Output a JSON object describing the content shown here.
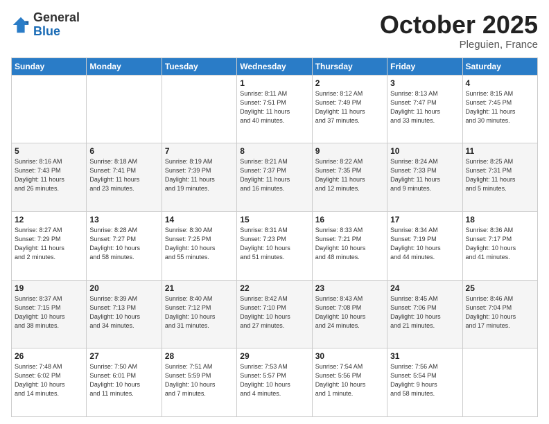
{
  "header": {
    "logo_general": "General",
    "logo_blue": "Blue",
    "month_title": "October 2025",
    "location": "Pleguien, France"
  },
  "days_of_week": [
    "Sunday",
    "Monday",
    "Tuesday",
    "Wednesday",
    "Thursday",
    "Friday",
    "Saturday"
  ],
  "weeks": [
    [
      {
        "day": "",
        "info": ""
      },
      {
        "day": "",
        "info": ""
      },
      {
        "day": "",
        "info": ""
      },
      {
        "day": "1",
        "info": "Sunrise: 8:11 AM\nSunset: 7:51 PM\nDaylight: 11 hours\nand 40 minutes."
      },
      {
        "day": "2",
        "info": "Sunrise: 8:12 AM\nSunset: 7:49 PM\nDaylight: 11 hours\nand 37 minutes."
      },
      {
        "day": "3",
        "info": "Sunrise: 8:13 AM\nSunset: 7:47 PM\nDaylight: 11 hours\nand 33 minutes."
      },
      {
        "day": "4",
        "info": "Sunrise: 8:15 AM\nSunset: 7:45 PM\nDaylight: 11 hours\nand 30 minutes."
      }
    ],
    [
      {
        "day": "5",
        "info": "Sunrise: 8:16 AM\nSunset: 7:43 PM\nDaylight: 11 hours\nand 26 minutes."
      },
      {
        "day": "6",
        "info": "Sunrise: 8:18 AM\nSunset: 7:41 PM\nDaylight: 11 hours\nand 23 minutes."
      },
      {
        "day": "7",
        "info": "Sunrise: 8:19 AM\nSunset: 7:39 PM\nDaylight: 11 hours\nand 19 minutes."
      },
      {
        "day": "8",
        "info": "Sunrise: 8:21 AM\nSunset: 7:37 PM\nDaylight: 11 hours\nand 16 minutes."
      },
      {
        "day": "9",
        "info": "Sunrise: 8:22 AM\nSunset: 7:35 PM\nDaylight: 11 hours\nand 12 minutes."
      },
      {
        "day": "10",
        "info": "Sunrise: 8:24 AM\nSunset: 7:33 PM\nDaylight: 11 hours\nand 9 minutes."
      },
      {
        "day": "11",
        "info": "Sunrise: 8:25 AM\nSunset: 7:31 PM\nDaylight: 11 hours\nand 5 minutes."
      }
    ],
    [
      {
        "day": "12",
        "info": "Sunrise: 8:27 AM\nSunset: 7:29 PM\nDaylight: 11 hours\nand 2 minutes."
      },
      {
        "day": "13",
        "info": "Sunrise: 8:28 AM\nSunset: 7:27 PM\nDaylight: 10 hours\nand 58 minutes."
      },
      {
        "day": "14",
        "info": "Sunrise: 8:30 AM\nSunset: 7:25 PM\nDaylight: 10 hours\nand 55 minutes."
      },
      {
        "day": "15",
        "info": "Sunrise: 8:31 AM\nSunset: 7:23 PM\nDaylight: 10 hours\nand 51 minutes."
      },
      {
        "day": "16",
        "info": "Sunrise: 8:33 AM\nSunset: 7:21 PM\nDaylight: 10 hours\nand 48 minutes."
      },
      {
        "day": "17",
        "info": "Sunrise: 8:34 AM\nSunset: 7:19 PM\nDaylight: 10 hours\nand 44 minutes."
      },
      {
        "day": "18",
        "info": "Sunrise: 8:36 AM\nSunset: 7:17 PM\nDaylight: 10 hours\nand 41 minutes."
      }
    ],
    [
      {
        "day": "19",
        "info": "Sunrise: 8:37 AM\nSunset: 7:15 PM\nDaylight: 10 hours\nand 38 minutes."
      },
      {
        "day": "20",
        "info": "Sunrise: 8:39 AM\nSunset: 7:13 PM\nDaylight: 10 hours\nand 34 minutes."
      },
      {
        "day": "21",
        "info": "Sunrise: 8:40 AM\nSunset: 7:12 PM\nDaylight: 10 hours\nand 31 minutes."
      },
      {
        "day": "22",
        "info": "Sunrise: 8:42 AM\nSunset: 7:10 PM\nDaylight: 10 hours\nand 27 minutes."
      },
      {
        "day": "23",
        "info": "Sunrise: 8:43 AM\nSunset: 7:08 PM\nDaylight: 10 hours\nand 24 minutes."
      },
      {
        "day": "24",
        "info": "Sunrise: 8:45 AM\nSunset: 7:06 PM\nDaylight: 10 hours\nand 21 minutes."
      },
      {
        "day": "25",
        "info": "Sunrise: 8:46 AM\nSunset: 7:04 PM\nDaylight: 10 hours\nand 17 minutes."
      }
    ],
    [
      {
        "day": "26",
        "info": "Sunrise: 7:48 AM\nSunset: 6:02 PM\nDaylight: 10 hours\nand 14 minutes."
      },
      {
        "day": "27",
        "info": "Sunrise: 7:50 AM\nSunset: 6:01 PM\nDaylight: 10 hours\nand 11 minutes."
      },
      {
        "day": "28",
        "info": "Sunrise: 7:51 AM\nSunset: 5:59 PM\nDaylight: 10 hours\nand 7 minutes."
      },
      {
        "day": "29",
        "info": "Sunrise: 7:53 AM\nSunset: 5:57 PM\nDaylight: 10 hours\nand 4 minutes."
      },
      {
        "day": "30",
        "info": "Sunrise: 7:54 AM\nSunset: 5:56 PM\nDaylight: 10 hours\nand 1 minute."
      },
      {
        "day": "31",
        "info": "Sunrise: 7:56 AM\nSunset: 5:54 PM\nDaylight: 9 hours\nand 58 minutes."
      },
      {
        "day": "",
        "info": ""
      }
    ]
  ]
}
